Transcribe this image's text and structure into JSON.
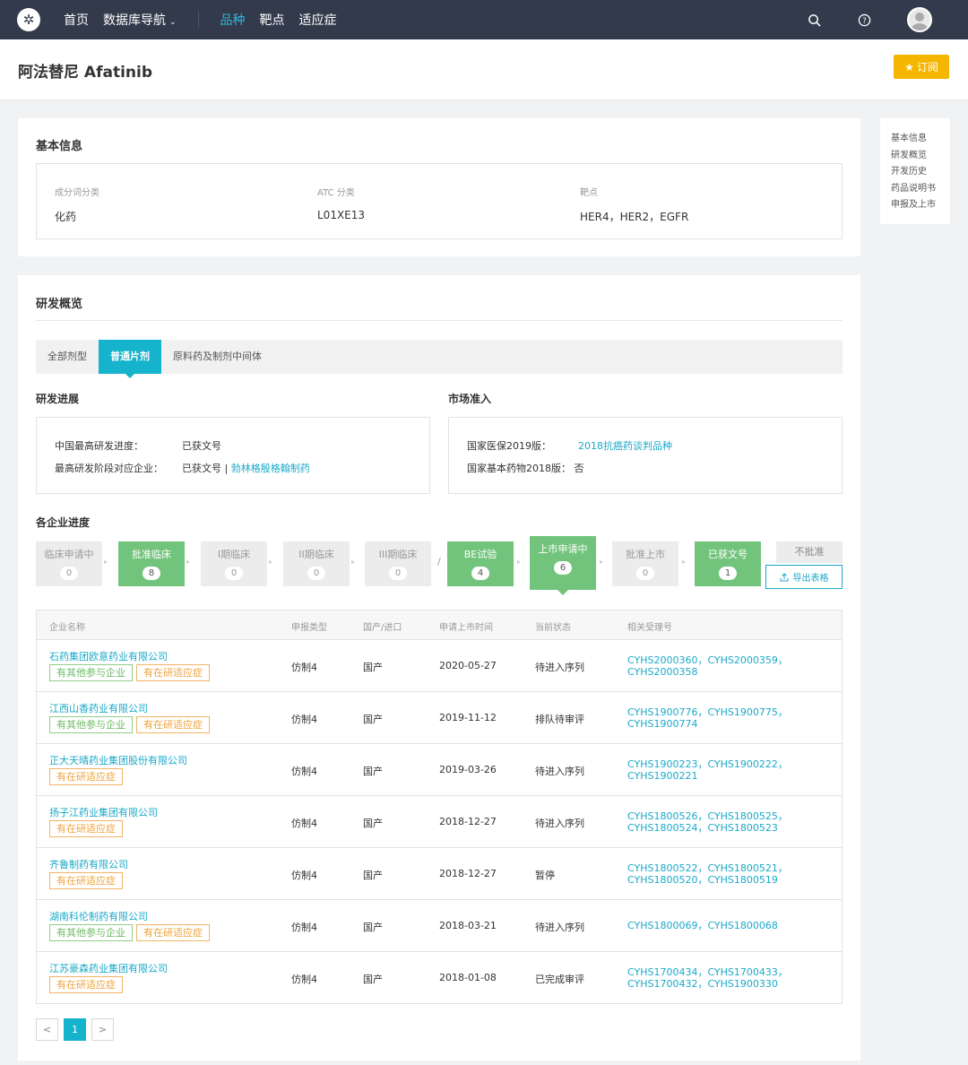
{
  "nav": {
    "items": [
      {
        "label": "首页"
      },
      {
        "label": "数据库导航"
      },
      {
        "label": "品种"
      },
      {
        "label": "靶点"
      },
      {
        "label": "适应症"
      }
    ]
  },
  "header": {
    "title": "阿法替尼 Afatinib",
    "subscribe_label": "订阅"
  },
  "sidenav": [
    "基本信息",
    "研发概览",
    "开发历史",
    "药品说明书",
    "申报及上市"
  ],
  "basic": {
    "title": "基本信息",
    "fields": [
      {
        "label": "成分词分类",
        "value": "化药"
      },
      {
        "label": "ATC 分类",
        "value": "L01XE13"
      },
      {
        "label": "靶点",
        "value": "HER4，HER2，EGFR"
      }
    ]
  },
  "overview": {
    "title": "研发概览",
    "tabs": [
      "全部剂型",
      "普通片剂",
      "原料药及制剂中间体"
    ],
    "progress_title": "研发进展",
    "progress": {
      "line1_label": "中国最高研发进度：",
      "line1_value": "已获文号",
      "line2_label": "最高研发阶段对应企业：",
      "line2_value": "已获文号 | ",
      "line2_link": "勃林格殷格翰制药"
    },
    "market_title": "市场准入",
    "market": {
      "line1_label": "国家医保2019版：",
      "line1_link": "2018抗癌药谈判品种",
      "line2": "国家基本药物2018版：  否"
    },
    "company_title": "各企业进度",
    "stages": [
      {
        "name": "临床申请中",
        "count": "0"
      },
      {
        "name": "批准临床",
        "count": "8"
      },
      {
        "name": "I期临床",
        "count": "0"
      },
      {
        "name": "II期临床",
        "count": "0"
      },
      {
        "name": "III期临床",
        "count": "0"
      },
      {
        "name": "BE试验",
        "count": "4"
      },
      {
        "name": "上市申请中",
        "count": "6"
      },
      {
        "name": "批准上市",
        "count": "0"
      },
      {
        "name": "已获文号",
        "count": "1"
      }
    ],
    "slash": "/",
    "reject_label": "不批准",
    "export_label": "导出表格",
    "table": {
      "headers": [
        "企业名称",
        "申报类型",
        "国产/进口",
        "申请上市时间",
        "当前状态",
        "相关受理号"
      ],
      "rows": [
        {
          "company": "石药集团欧意药业有限公司",
          "tags": [
            {
              "t": "有其他参与企业",
              "c": "g"
            },
            {
              "t": "有在研适应症",
              "c": "o"
            }
          ],
          "type": "仿制4",
          "origin": "国产",
          "date": "2020-05-27",
          "status": "待进入序列",
          "acc1": "CYHS2000360，CYHS2000359，",
          "acc2": "CYHS2000358"
        },
        {
          "company": "江西山香药业有限公司",
          "tags": [
            {
              "t": "有其他参与企业",
              "c": "g"
            },
            {
              "t": "有在研适应症",
              "c": "o"
            }
          ],
          "type": "仿制4",
          "origin": "国产",
          "date": "2019-11-12",
          "status": "排队待审评",
          "acc1": "CYHS1900776，CYHS1900775，",
          "acc2": "CYHS1900774"
        },
        {
          "company": "正大天晴药业集团股份有限公司",
          "tags": [
            {
              "t": "有在研适应症",
              "c": "o"
            }
          ],
          "type": "仿制4",
          "origin": "国产",
          "date": "2019-03-26",
          "status": "待进入序列",
          "acc1": "CYHS1900223，CYHS1900222，",
          "acc2": "CYHS1900221"
        },
        {
          "company": "扬子江药业集团有限公司",
          "tags": [
            {
              "t": "有在研适应症",
              "c": "o"
            }
          ],
          "type": "仿制4",
          "origin": "国产",
          "date": "2018-12-27",
          "status": "待进入序列",
          "acc1": "CYHS1800526，CYHS1800525，",
          "acc2": "CYHS1800524，CYHS1800523"
        },
        {
          "company": "齐鲁制药有限公司",
          "tags": [
            {
              "t": "有在研适应症",
              "c": "o"
            }
          ],
          "type": "仿制4",
          "origin": "国产",
          "date": "2018-12-27",
          "status": "暂停",
          "acc1": "CYHS1800522，CYHS1800521，",
          "acc2": "CYHS1800520，CYHS1800519"
        },
        {
          "company": "湖南科伦制药有限公司",
          "tags": [
            {
              "t": "有其他参与企业",
              "c": "g"
            },
            {
              "t": "有在研适应症",
              "c": "o"
            }
          ],
          "type": "仿制4",
          "origin": "国产",
          "date": "2018-03-21",
          "status": "待进入序列",
          "acc1": "CYHS1800069，CYHS1800068",
          "acc2": ""
        },
        {
          "company": "江苏豪森药业集团有限公司",
          "tags": [
            {
              "t": "有在研适应症",
              "c": "o"
            }
          ],
          "type": "仿制4",
          "origin": "国产",
          "date": "2018-01-08",
          "status": "已完成审评",
          "acc1": "CYHS1700434，CYHS1700433，",
          "acc2": "CYHS1700432，CYHS1900330"
        }
      ]
    },
    "pager": {
      "prev": "<",
      "current": "1",
      "next": ">"
    }
  },
  "colors": {
    "topbar": "#323a4c",
    "accent": "#16b3cc",
    "stage_active": "#72c47c",
    "subscribe": "#f5b600"
  }
}
